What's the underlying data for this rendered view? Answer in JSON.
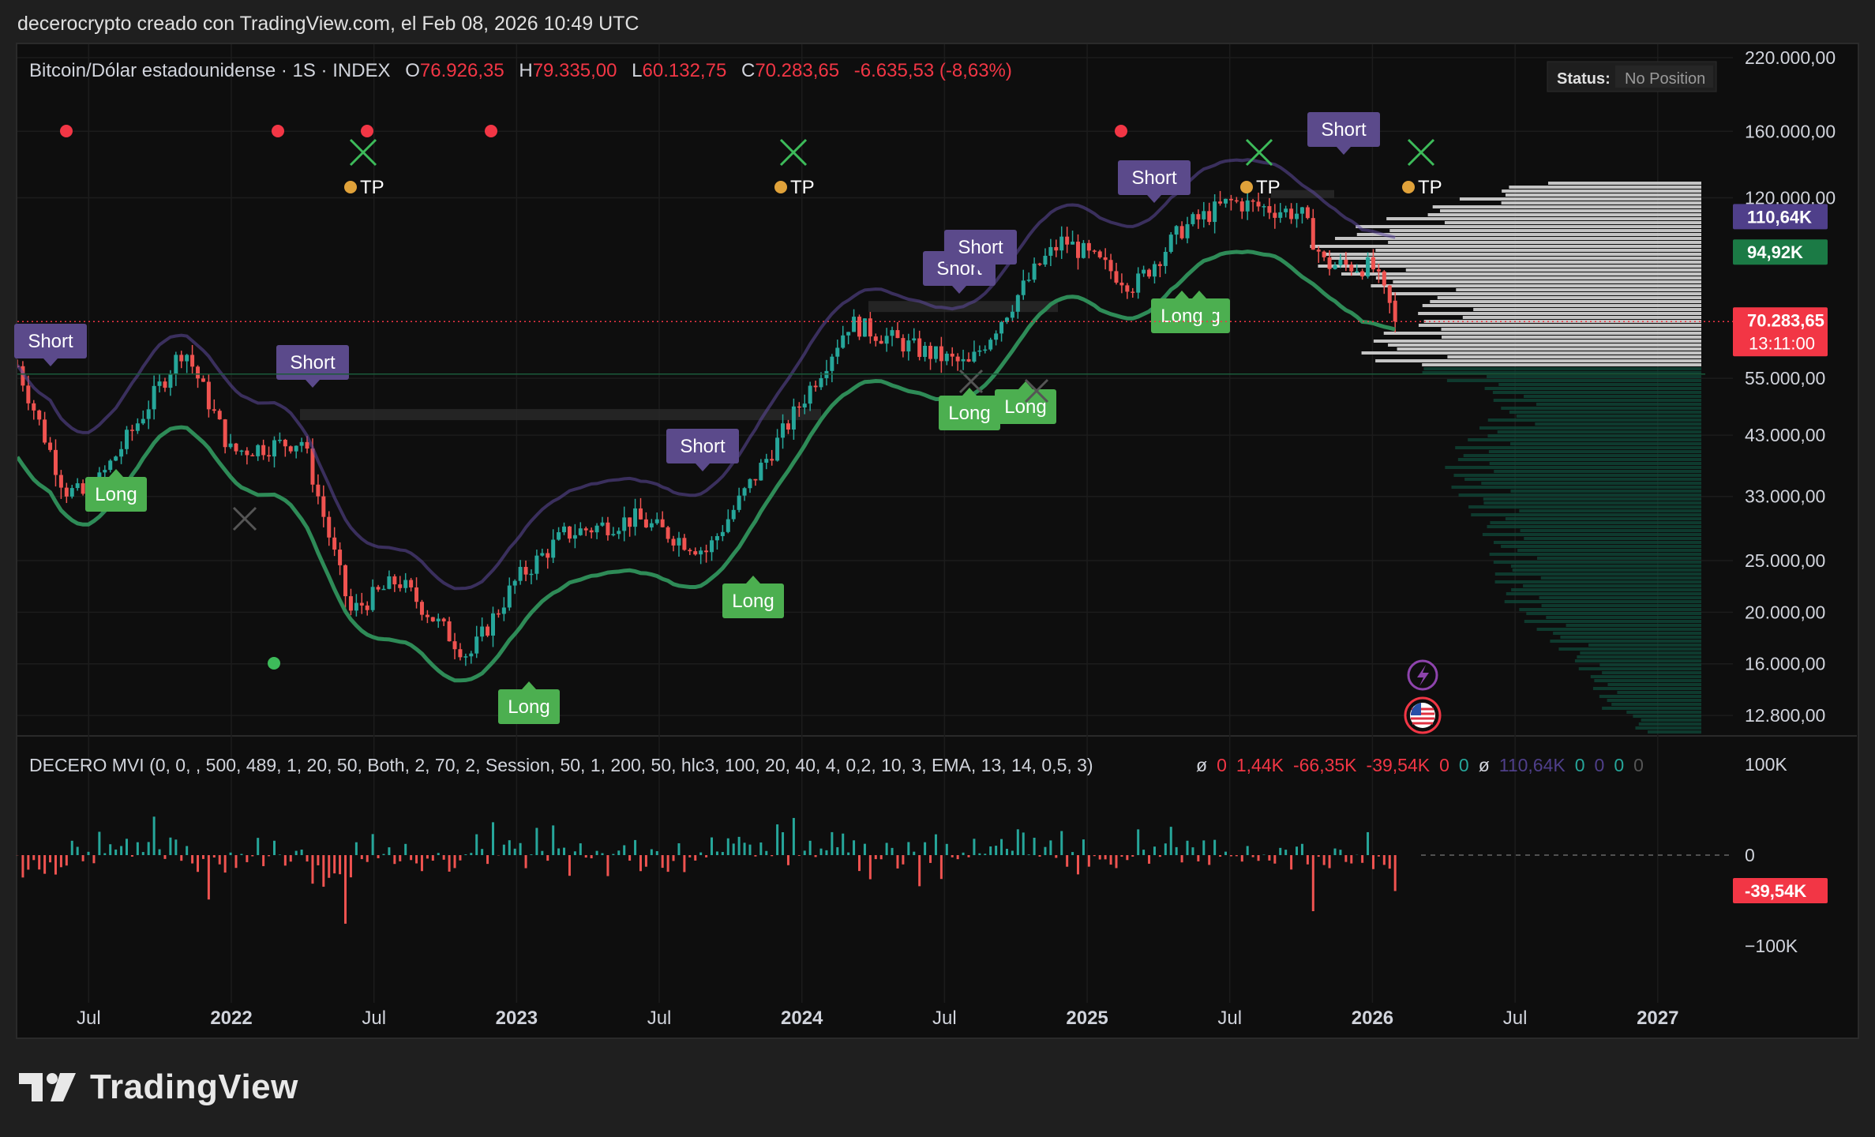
{
  "attribution": "decerocrypto creado con TradingView.com, el Feb 08, 2026 10:49 UTC",
  "header": {
    "symbol": "Bitcoin/Dólar estadounidense · 1S · INDEX",
    "o_label": "O",
    "o": "76.926,35",
    "h_label": "H",
    "h": "79.335,00",
    "l_label": "L",
    "l": "60.132,75",
    "c_label": "C",
    "c": "70.283,65",
    "change": "-6.635,53 (-8,63%)"
  },
  "status": {
    "label": "Status:",
    "value": "No Position"
  },
  "colors": {
    "background": "#0e0e0e",
    "up": "#26a69a",
    "down": "#ef5350",
    "long": "#4caf50",
    "short": "#5b4a8b",
    "support_line": "#2e8b57",
    "resistance_line": "#5e4a9e",
    "price_label": "#f23645",
    "level_purple": "#4f3f8a",
    "level_green": "#1b7a45"
  },
  "price_axis": {
    "ticks": [
      "220.000,00",
      "160.000,00",
      "120.000,00",
      "94.92K_hidden",
      "55.000,00",
      "43.000,00",
      "33.000,00",
      "25.000,00",
      "20.000,00",
      "16.000,00",
      "12.800,00"
    ],
    "tick_values": [
      220000,
      160000,
      120000,
      55000,
      43000,
      33000,
      25000,
      20000,
      16000,
      12800
    ],
    "tick_labels": [
      "220.000,00",
      "160.000,00",
      "120.000,00",
      "55.000,00",
      "43.000,00",
      "33.000,00",
      "25.000,00",
      "20.000,00",
      "16.000,00",
      "12.800,00"
    ],
    "scale": "log",
    "badges": [
      {
        "text": "110,64K",
        "value": 110640,
        "color": "#4f3f8a"
      },
      {
        "text": "94,92K",
        "value": 94920,
        "color": "#1b7a45"
      },
      {
        "text": "70.283,65",
        "value": 70283.65,
        "color": "#f23645"
      }
    ],
    "countdown": "13:11:00"
  },
  "time_axis": {
    "labels": [
      "Jul",
      "2022",
      "Jul",
      "2023",
      "Jul",
      "2024",
      "Jul",
      "2025",
      "Jul",
      "2026",
      "Jul",
      "2027"
    ],
    "dates": [
      "2021-07",
      "2022-01",
      "2022-07",
      "2023-01",
      "2023-07",
      "2024-01",
      "2024-07",
      "2025-01",
      "2025-07",
      "2026-01",
      "2026-07",
      "2027-01"
    ]
  },
  "signals": {
    "short": [
      "Short",
      "Short",
      "Short",
      "Short",
      "Short",
      "Short",
      "Short"
    ],
    "long": [
      "Long",
      "Long",
      "Long",
      "Long",
      "Long",
      "Long",
      "Long"
    ],
    "tp": [
      "TP",
      "TP",
      "TP",
      "TP"
    ]
  },
  "indicator": {
    "title": "DECERO MVI (0, 0, , 500, 489, 1, 20, 50, Both, 2, 70, 2, Session, 50, 1, 200, 50, hlc3, 100, 20, 40, 4, 0,2, 10, 3, EMA, 13, 14, 0,5, 3)",
    "values": [
      {
        "text": "ø",
        "color": "#d1d4dc"
      },
      {
        "text": "0",
        "color": "#f23645"
      },
      {
        "text": "1,44K",
        "color": "#f23645"
      },
      {
        "text": "-66,35K",
        "color": "#f23645"
      },
      {
        "text": "-39,54K",
        "color": "#f23645"
      },
      {
        "text": "0",
        "color": "#f23645"
      },
      {
        "text": "0",
        "color": "#26a69a"
      },
      {
        "text": "ø",
        "color": "#d1d4dc"
      },
      {
        "text": "110,64K",
        "color": "#4f3f8a"
      },
      {
        "text": "0",
        "color": "#26a69a"
      },
      {
        "text": "0",
        "color": "#4f3f8a"
      },
      {
        "text": "0",
        "color": "#26a69a"
      },
      {
        "text": "0",
        "color": "#555555"
      }
    ],
    "axis": [
      "100K",
      "0",
      "−100K"
    ],
    "current_badge": "-39,54K"
  },
  "chart_data": {
    "type": "candlestick",
    "title": "Bitcoin/Dólar estadounidense · 1S · INDEX",
    "scale": "log",
    "ylim": [
      12000,
      230000
    ],
    "x_range": [
      "2021-04",
      "2027-03"
    ],
    "grid": true,
    "approx_close_path": [
      [
        "2021-04",
        58000
      ],
      [
        "2021-06",
        34000
      ],
      [
        "2021-07",
        33000
      ],
      [
        "2021-09",
        45000
      ],
      [
        "2021-11",
        63000
      ],
      [
        "2022-01",
        40000
      ],
      [
        "2022-04",
        42000
      ],
      [
        "2022-06",
        20000
      ],
      [
        "2022-08",
        23000
      ],
      [
        "2022-11",
        16500
      ],
      [
        "2023-01",
        23000
      ],
      [
        "2023-03",
        28000
      ],
      [
        "2023-06",
        30000
      ],
      [
        "2023-09",
        26000
      ],
      [
        "2023-12",
        42000
      ],
      [
        "2024-03",
        70000
      ],
      [
        "2024-06",
        62000
      ],
      [
        "2024-08",
        58000
      ],
      [
        "2024-11",
        90000
      ],
      [
        "2024-12",
        100000
      ],
      [
        "2025-03",
        82000
      ],
      [
        "2025-05",
        105000
      ],
      [
        "2025-07",
        118000
      ],
      [
        "2025-10",
        112000
      ],
      [
        "2025-11",
        90000
      ],
      [
        "2026-01",
        89000
      ],
      [
        "2026-02",
        70283.65
      ]
    ],
    "last": {
      "open": 76926.35,
      "high": 79335.0,
      "low": 60132.75,
      "close": 70283.65
    }
  }
}
